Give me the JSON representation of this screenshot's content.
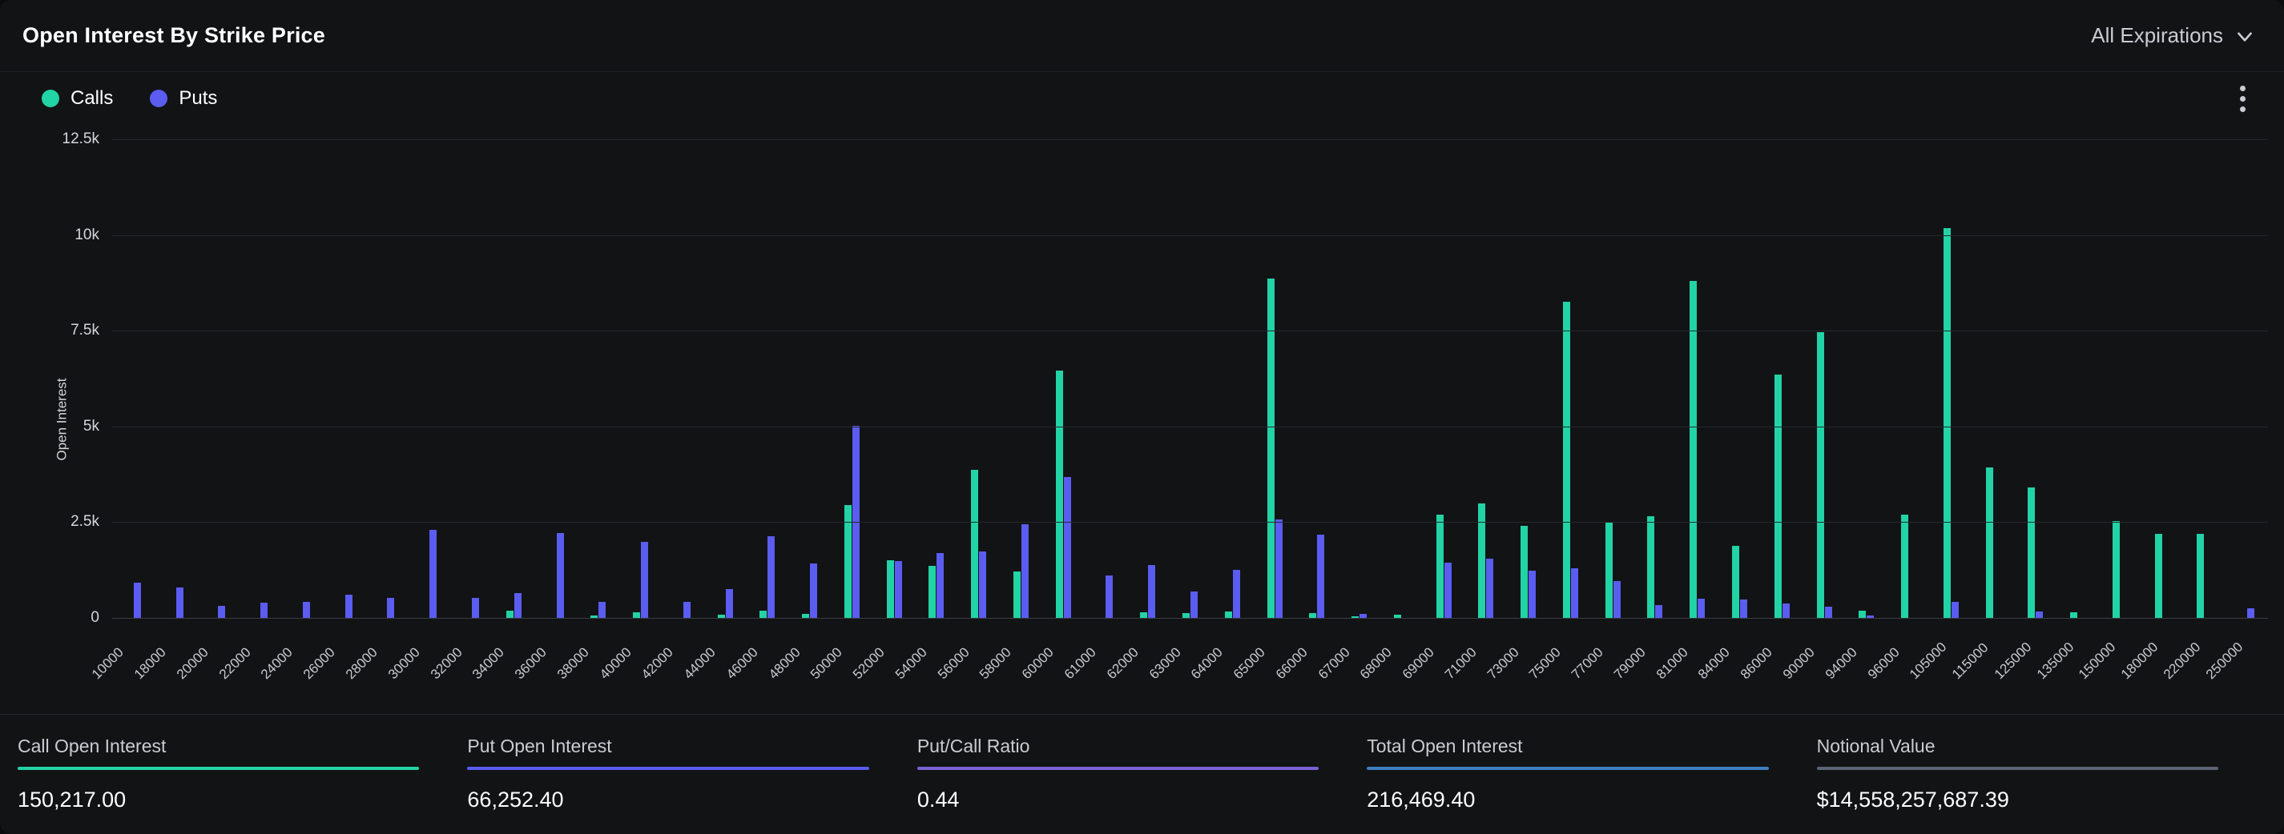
{
  "header": {
    "title": "Open Interest By Strike Price",
    "expiration_filter": "All Expirations",
    "chevron_icon": "chevron-down-icon",
    "menu_icon": "kebab-menu-icon"
  },
  "legend": [
    {
      "label": "Calls",
      "color": "#22d3a5",
      "icon": "legend-dot-icon"
    },
    {
      "label": "Puts",
      "color": "#5b5cf0",
      "icon": "legend-dot-icon"
    }
  ],
  "colors": {
    "calls": "#22d3a5",
    "puts": "#5b5cf0",
    "ratio": "#7b62d4",
    "total": "#3d7ec0",
    "notional": "#5a6474",
    "panel_bg": "#121315",
    "grid": "#26272b"
  },
  "stats": [
    {
      "label": "Call Open Interest",
      "value": "150,217.00",
      "color": "#22d3a5"
    },
    {
      "label": "Put Open Interest",
      "value": "66,252.40",
      "color": "#5b5cf0"
    },
    {
      "label": "Put/Call Ratio",
      "value": "0.44",
      "color": "#7b62d4"
    },
    {
      "label": "Total Open Interest",
      "value": "216,469.40",
      "color": "#3d7ec0"
    },
    {
      "label": "Notional Value",
      "value": "$14,558,257,687.39",
      "color": "#5a6474"
    }
  ],
  "chart_data": {
    "type": "bar",
    "title": "Open Interest By Strike Price",
    "xlabel": "",
    "ylabel": "Open Interest",
    "ylim": [
      0,
      12500
    ],
    "yticks": [
      0,
      2500,
      5000,
      7500,
      10000,
      12500
    ],
    "ytick_labels": [
      "0",
      "2.5k",
      "5k",
      "7.5k",
      "10k",
      "12.5k"
    ],
    "grid": true,
    "legend_position": "top-left",
    "categories": [
      "10000",
      "18000",
      "20000",
      "22000",
      "24000",
      "26000",
      "28000",
      "30000",
      "32000",
      "34000",
      "36000",
      "38000",
      "40000",
      "42000",
      "44000",
      "46000",
      "48000",
      "50000",
      "52000",
      "54000",
      "56000",
      "58000",
      "60000",
      "61000",
      "62000",
      "63000",
      "64000",
      "65000",
      "66000",
      "67000",
      "68000",
      "69000",
      "71000",
      "73000",
      "75000",
      "77000",
      "79000",
      "81000",
      "84000",
      "86000",
      "90000",
      "94000",
      "96000",
      "105000",
      "115000",
      "125000",
      "135000",
      "150000",
      "180000",
      "220000",
      "250000"
    ],
    "series": [
      {
        "name": "Calls",
        "color": "#22d3a5",
        "values": [
          0,
          0,
          0,
          0,
          0,
          0,
          0,
          0,
          0,
          180,
          0,
          60,
          140,
          0,
          90,
          180,
          110,
          2950,
          1500,
          1350,
          3870,
          1210,
          6450,
          0,
          140,
          120,
          170,
          8870,
          130,
          40,
          90,
          2700,
          2980,
          2400,
          8250,
          2480,
          2650,
          8800,
          1880,
          6350,
          7460,
          190,
          2700,
          10180,
          3930,
          3400,
          150,
          2530,
          2200,
          2200,
          0
        ]
      },
      {
        "name": "Puts",
        "color": "#5b5cf0",
        "values": [
          930,
          800,
          320,
          400,
          420,
          600,
          530,
          2300,
          520,
          640,
          2220,
          420,
          1980,
          420,
          760,
          2140,
          1420,
          5020,
          1490,
          1700,
          1730,
          2450,
          3670,
          1100,
          1370,
          680,
          1260,
          2570,
          2180,
          100,
          0,
          1450,
          1550,
          1230,
          1300,
          960,
          330,
          510,
          490,
          380,
          290,
          60,
          0,
          420,
          0,
          160,
          0,
          0,
          0,
          0,
          260
        ]
      }
    ]
  }
}
